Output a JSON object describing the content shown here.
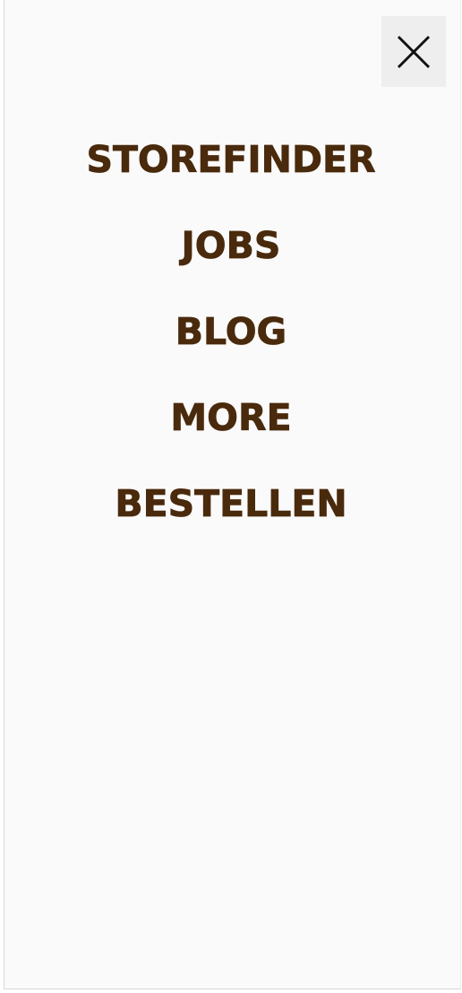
{
  "menu": {
    "items": [
      {
        "label": "STOREFINDER"
      },
      {
        "label": "JOBS"
      },
      {
        "label": "BLOG"
      },
      {
        "label": "MORE"
      },
      {
        "label": "BESTELLEN"
      }
    ],
    "close_icon": "close-icon"
  },
  "colors": {
    "text": "#4a2a0c",
    "background": "#fafafa",
    "close_button_bg": "#eeeeee"
  }
}
